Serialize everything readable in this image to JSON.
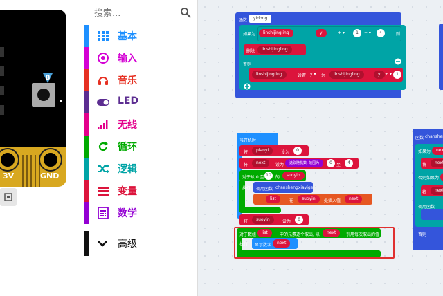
{
  "simulator": {
    "button_b_label": "B",
    "pad_3v_label": "3V",
    "pad_gnd_label": "GND"
  },
  "toolbox": {
    "search": {
      "placeholder": "搜索..."
    },
    "categories": [
      {
        "label": "基本",
        "color": "#1e90ff",
        "icon": "grid-icon"
      },
      {
        "label": "输入",
        "color": "#d400d4",
        "icon": "target-icon"
      },
      {
        "label": "音乐",
        "color": "#e63022",
        "icon": "headphones-icon"
      },
      {
        "label": "LED",
        "color": "#5c2d91",
        "icon": "toggle-icon"
      },
      {
        "label": "无线",
        "color": "#e3008c",
        "icon": "signal-bars-icon"
      },
      {
        "label": "循环",
        "color": "#00aa00",
        "icon": "refresh-icon"
      },
      {
        "label": "逻辑",
        "color": "#00a4a6",
        "icon": "shuffle-icon"
      },
      {
        "label": "变量",
        "color": "#dc143c",
        "icon": "list-icon"
      },
      {
        "label": "数学",
        "color": "#9400d3",
        "icon": "calculator-icon"
      }
    ],
    "advanced": {
      "label": "高级",
      "icon": "chevron-down-icon"
    }
  },
  "workspace": {
    "func_yidong": {
      "header_kw": "函数",
      "header_name": "yidong",
      "if_kw": "如果为",
      "var_a": "linshijingling",
      "prop_y": "y",
      "op_add": "+ ▾",
      "num_1": "1",
      "op_eq": "= ▾",
      "num_4": "4",
      "then_kw": "则",
      "delete_kw": "删除",
      "var_b": "linshijingling",
      "else_kw": "否则",
      "var_c": "linshijingling",
      "set_kw": "设置",
      "prop_y2": "y ▾",
      "as_kw": "为",
      "var_d": "linshijingling",
      "prop_y3": "y",
      "op_add2": "+ ▾",
      "num_1b": "1"
    },
    "on_start": {
      "header": "当开机时",
      "row1_kw": "将",
      "row1_var": "pianyi",
      "row1_as": "设为",
      "row1_num": "0",
      "row2_kw": "将",
      "row2_var": "next",
      "row2_as": "设为",
      "row2_fn": "选取随机数, 范围为",
      "row2_from": "0",
      "row2_to_kw": "至",
      "row2_to": "4",
      "row3_for": "对于从 0 至",
      "row3_num": "10",
      "row3_of": "的",
      "row3_var": "suoyin",
      "row4_exec": "执行",
      "row4_call": "调用函数",
      "row4_fn": "chanshengxiayige",
      "row5_list": "list",
      "row5_at": "在",
      "row5_idx": "suoyin",
      "row5_insert": "处插入值",
      "row5_val": "next",
      "row6_kw": "将",
      "row6_var": "suoyin",
      "row6_as": "设为",
      "row6_num": "0",
      "row7_foreach": "对于数组",
      "row7_list": "list",
      "row7_text": "中的元素逐个取出, 以",
      "row7_var": "next",
      "row7_tail": "引用每次取出的值",
      "row8_exec": "执行",
      "row8_show": "显示数字",
      "row8_var": "next"
    },
    "func_right": {
      "header_kw": "函数",
      "header_name": "chanshengxiayige",
      "row1": "如果为",
      "row1_var": "next",
      "row2": "将",
      "row2_var": "next",
      "row3": "否则如果为",
      "row3_var": "next",
      "row4": "将",
      "row4_var": "next",
      "row5": "调用函数",
      "row6": "否则"
    }
  },
  "colors": {
    "function_block": "#3455db",
    "logic_block": "#00a4a6",
    "variable_block": "#dc143c",
    "loops_block": "#00aa00",
    "basic_block": "#1e90ff",
    "array_block": "#e65722",
    "highlight": "#e03030"
  }
}
